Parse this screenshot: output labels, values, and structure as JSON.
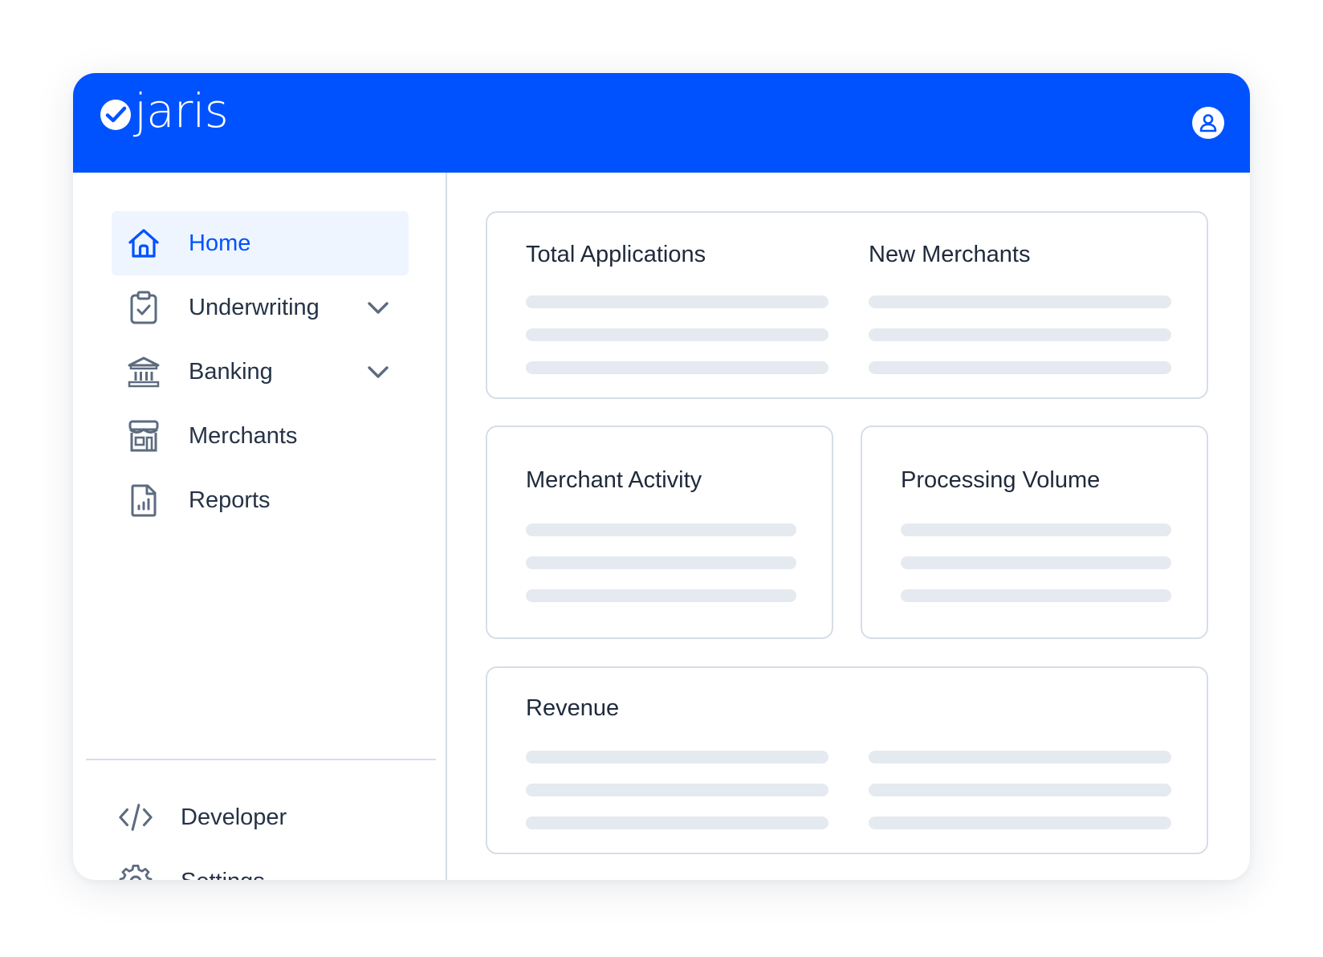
{
  "brand": {
    "name": "jaris"
  },
  "sidebar": {
    "items": [
      {
        "label": "Home",
        "icon": "home-icon",
        "active": true
      },
      {
        "label": "Underwriting",
        "icon": "clipboard-check-icon",
        "expandable": true
      },
      {
        "label": "Banking",
        "icon": "bank-icon",
        "expandable": true
      },
      {
        "label": "Merchants",
        "icon": "storefront-icon"
      },
      {
        "label": "Reports",
        "icon": "report-chart-icon"
      }
    ],
    "bottom_items": [
      {
        "label": "Developer",
        "icon": "code-icon"
      },
      {
        "label": "Settings",
        "icon": "gear-icon"
      }
    ]
  },
  "cards": {
    "total_applications": {
      "title": "Total Applications"
    },
    "new_merchants": {
      "title": "New Merchants"
    },
    "merchant_activity": {
      "title": "Merchant Activity"
    },
    "processing_volume": {
      "title": "Processing Volume"
    },
    "revenue": {
      "title": "Revenue"
    }
  },
  "colors": {
    "brand_blue": "#0052ff",
    "active_bg": "#eff5ff",
    "skeleton": "#e5e9f0",
    "border": "#d6dde8",
    "icon_gray": "#5c6b80"
  }
}
